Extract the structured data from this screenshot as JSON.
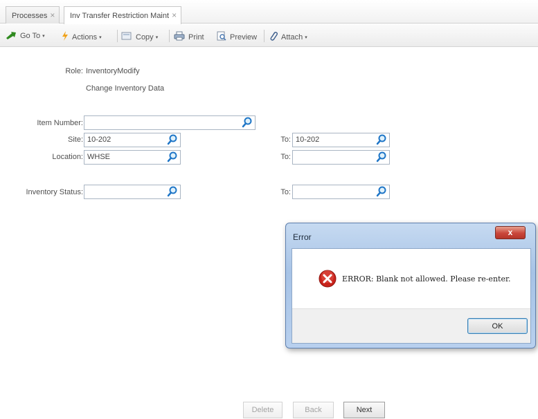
{
  "tabs": [
    {
      "label": "Processes",
      "close": "×"
    },
    {
      "label": "Inv Transfer Restriction Maint",
      "close": "×"
    }
  ],
  "toolbar": {
    "goto": "Go To",
    "actions": "Actions",
    "copy": "Copy",
    "print": "Print",
    "preview": "Preview",
    "attach": "Attach",
    "caret": "▾"
  },
  "role": {
    "label": "Role:",
    "value": "InventoryModify",
    "desc": "Change Inventory Data"
  },
  "form": {
    "item_number": {
      "label": "Item Number:",
      "value": ""
    },
    "site": {
      "label": "Site:",
      "from": "10-202",
      "to_label": "To:",
      "to": "10-202"
    },
    "location": {
      "label": "Location:",
      "from": "WHSE",
      "to_label": "To:",
      "to": ""
    },
    "inventory_status": {
      "label": "Inventory Status:",
      "from": "",
      "to_label": "To:",
      "to": ""
    }
  },
  "dialog": {
    "title": "Error",
    "close": "x",
    "message": "ERROR: Blank not allowed.  Please re-enter.",
    "ok": "OK"
  },
  "buttons": {
    "delete": "Delete",
    "back": "Back",
    "next": "Next"
  },
  "icons": {
    "goto": "go-to-arrow-icon",
    "actions": "lightning-icon",
    "copy": "copy-icon",
    "print": "printer-icon",
    "preview": "preview-icon",
    "attach": "paperclip-icon",
    "lookup": "magnifier-icon",
    "error": "error-circle-icon"
  }
}
